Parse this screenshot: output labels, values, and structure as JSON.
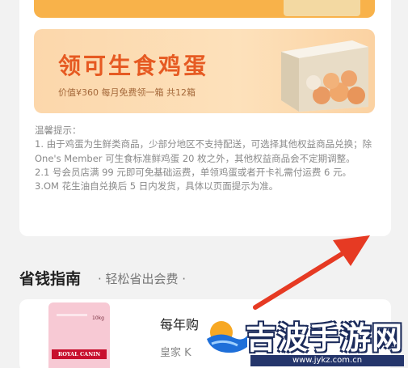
{
  "egg_banner": {
    "title": "领可生食鸡蛋",
    "subtitle": "价值¥360 每月免费领一箱 共12箱"
  },
  "notice": {
    "heading": "温馨提示：",
    "items": [
      "1. 由于鸡蛋为生鲜类商品，少部分地区不支持配送，可选择其他权益商品兑换；除 One's Member 可生食标准鲜鸡蛋 20 枚之外，其他权益商品会不定期调整。",
      "2.1 号会员店满 99 元即可免基础运费，单领鸡蛋或者开卡礼需付运费 6 元。",
      "3.OM 花生油自兑换后 5 日内发货，具体以页面提示为准。"
    ]
  },
  "guide": {
    "title": "省钱指南",
    "subtitle": "· 轻松省出会费 ·"
  },
  "product": {
    "name": "每年购",
    "desc": "皇家 K",
    "brand": "ROYAL CANIN",
    "weight": "10kg"
  },
  "watermark": {
    "text": "吉波手游网",
    "url": "www.jykz.com.cn"
  },
  "colors": {
    "accent": "#e65a22",
    "arrow": "#e63a23",
    "brand_red": "#c8102e"
  }
}
